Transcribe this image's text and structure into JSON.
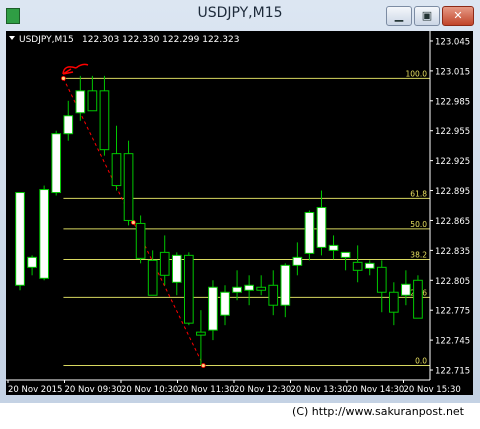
{
  "window": {
    "title": "USDJPY,M15"
  },
  "header": {
    "symbol_label": "USDJPY,M15",
    "ohlc": "122.303 122.330 122.299 122.323"
  },
  "footer": {
    "credit": "(C) http://www.sakuranpost.net"
  },
  "colors": {
    "background": "#000000",
    "bull_body": "#ffffff",
    "wick": "#00c800",
    "bear_body": "#000000",
    "fib_line": "#d8d860",
    "fib_label": "#e8e060",
    "axis_text": "#ffffff",
    "trend_line": "#ff0000",
    "annotation": "#ff0000"
  },
  "chart_data": {
    "type": "candlestick",
    "symbol": "USDJPY",
    "timeframe": "M15",
    "ylim": [
      122.705,
      123.055
    ],
    "y_ticks": [
      "123.045",
      "123.015",
      "122.985",
      "122.955",
      "122.925",
      "122.895",
      "122.865",
      "122.835",
      "122.805",
      "122.775",
      "122.745",
      "122.715"
    ],
    "x_ticks": [
      "20 Nov 2015",
      "20 Nov 09:30",
      "20 Nov 10:30",
      "20 Nov 11:30",
      "20 Nov 12:30",
      "20 Nov 13:30",
      "20 Nov 14:30",
      "20 Nov 15:30"
    ],
    "fibonacci": [
      {
        "label": "100.0",
        "price": 123.0075
      },
      {
        "label": "61.8",
        "price": 122.8872
      },
      {
        "label": "50.0",
        "price": 122.8566
      },
      {
        "label": "38.2",
        "price": 122.8258
      },
      {
        "label": "23.6",
        "price": 122.7879
      },
      {
        "label": "0.0",
        "price": 122.7195
      }
    ],
    "candles": [
      {
        "o": 122.8,
        "h": 122.893,
        "l": 122.795,
        "c": 122.893
      },
      {
        "o": 122.818,
        "h": 122.83,
        "l": 122.81,
        "c": 122.828
      },
      {
        "o": 122.807,
        "h": 122.9,
        "l": 122.805,
        "c": 122.896
      },
      {
        "o": 122.893,
        "h": 122.955,
        "l": 122.89,
        "c": 122.952
      },
      {
        "o": 122.952,
        "h": 122.985,
        "l": 122.945,
        "c": 122.97
      },
      {
        "o": 122.973,
        "h": 123.01,
        "l": 122.965,
        "c": 122.995
      },
      {
        "o": 122.995,
        "h": 123.01,
        "l": 122.975,
        "c": 122.975
      },
      {
        "o": 122.995,
        "h": 123.01,
        "l": 122.93,
        "c": 122.936
      },
      {
        "o": 122.932,
        "h": 122.96,
        "l": 122.895,
        "c": 122.9
      },
      {
        "o": 122.932,
        "h": 122.945,
        "l": 122.86,
        "c": 122.865
      },
      {
        "o": 122.862,
        "h": 122.87,
        "l": 122.822,
        "c": 122.827
      },
      {
        "o": 122.825,
        "h": 122.835,
        "l": 122.79,
        "c": 122.79
      },
      {
        "o": 122.833,
        "h": 122.85,
        "l": 122.8,
        "c": 122.81
      },
      {
        "o": 122.803,
        "h": 122.833,
        "l": 122.79,
        "c": 122.83
      },
      {
        "o": 122.83,
        "h": 122.833,
        "l": 122.76,
        "c": 122.762
      },
      {
        "o": 122.753,
        "h": 122.775,
        "l": 122.72,
        "c": 122.75
      },
      {
        "o": 122.755,
        "h": 122.805,
        "l": 122.745,
        "c": 122.798
      },
      {
        "o": 122.77,
        "h": 122.8,
        "l": 122.76,
        "c": 122.793
      },
      {
        "o": 122.793,
        "h": 122.815,
        "l": 122.785,
        "c": 122.798
      },
      {
        "o": 122.795,
        "h": 122.81,
        "l": 122.78,
        "c": 122.8
      },
      {
        "o": 122.798,
        "h": 122.81,
        "l": 122.79,
        "c": 122.795
      },
      {
        "o": 122.8,
        "h": 122.815,
        "l": 122.77,
        "c": 122.78
      },
      {
        "o": 122.78,
        "h": 122.822,
        "l": 122.768,
        "c": 122.82
      },
      {
        "o": 122.82,
        "h": 122.843,
        "l": 122.81,
        "c": 122.828
      },
      {
        "o": 122.832,
        "h": 122.875,
        "l": 122.825,
        "c": 122.873
      },
      {
        "o": 122.838,
        "h": 122.895,
        "l": 122.83,
        "c": 122.878
      },
      {
        "o": 122.835,
        "h": 122.85,
        "l": 122.826,
        "c": 122.84
      },
      {
        "o": 122.828,
        "h": 122.833,
        "l": 122.815,
        "c": 122.833
      },
      {
        "o": 122.823,
        "h": 122.84,
        "l": 122.803,
        "c": 122.815
      },
      {
        "o": 122.817,
        "h": 122.825,
        "l": 122.81,
        "c": 122.822
      },
      {
        "o": 122.818,
        "h": 122.825,
        "l": 122.773,
        "c": 122.793
      },
      {
        "o": 122.793,
        "h": 122.803,
        "l": 122.76,
        "c": 122.773
      },
      {
        "o": 122.79,
        "h": 122.815,
        "l": 122.78,
        "c": 122.801
      },
      {
        "o": 122.805,
        "h": 122.81,
        "l": 122.768,
        "c": 122.767
      }
    ]
  }
}
